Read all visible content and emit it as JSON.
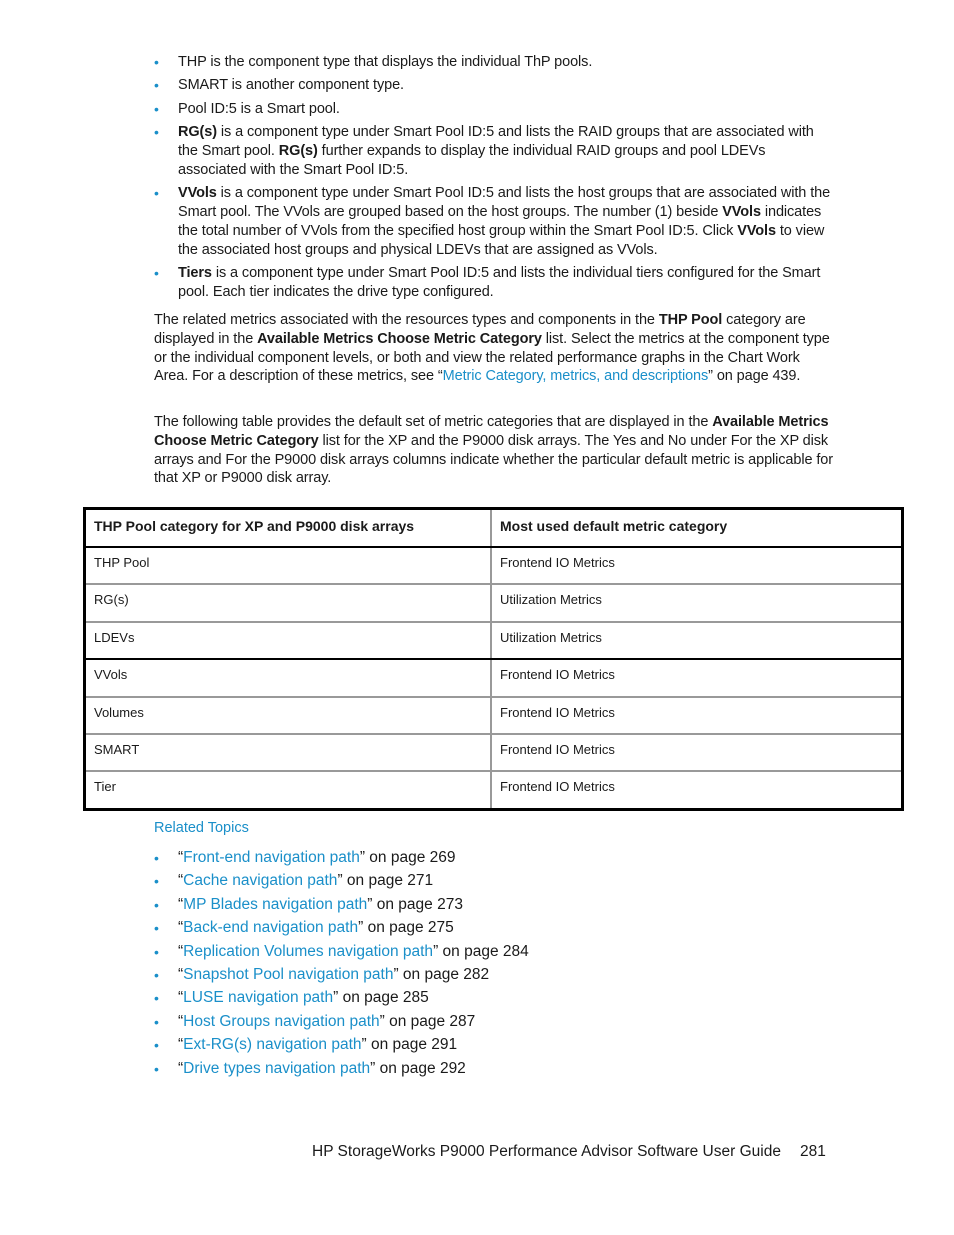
{
  "bullets": [
    {
      "bold": "",
      "text": "THP is the component type that displays the individual ThP pools."
    },
    {
      "bold": "",
      "text": "SMART is another component type."
    },
    {
      "bold": "",
      "text": "Pool ID:5 is a Smart pool."
    },
    {
      "segments": [
        {
          "b": "RG(s)"
        },
        {
          "t": " is a component type under Smart Pool ID:5 and lists the RAID groups that are associated with the Smart pool. "
        },
        {
          "b": "RG(s)"
        },
        {
          "t": " further expands to display the individual RAID groups and pool LDEVs associated with the Smart Pool ID:5."
        }
      ]
    },
    {
      "segments": [
        {
          "b": "VVols"
        },
        {
          "t": " is a component type under Smart Pool ID:5 and lists the host groups that are associated with the Smart pool. The VVols are grouped based on the host groups. The number (1) beside "
        },
        {
          "b": "VVols"
        },
        {
          "t": " indicates the total number of VVols from the specified host group within the Smart Pool ID:5. Click "
        },
        {
          "b": "VVols"
        },
        {
          "t": " to view the associated host groups and physical LDEVs that are assigned as VVols."
        }
      ]
    },
    {
      "segments": [
        {
          "b": "Tiers"
        },
        {
          "t": " is a component type under Smart Pool ID:5 and lists the individual tiers configured for the Smart pool. Each tier indicates the drive type configured."
        }
      ]
    }
  ],
  "para1": {
    "t1": "The related metrics associated with the resources types and components in the ",
    "b1": "THP Pool",
    "t2": " category are displayed in the ",
    "b2": "Available Metrics Choose Metric Category",
    "t3": " list. Select the metrics at the component type or the individual component levels, or both and view the related performance graphs in the Chart Work Area. For a description of these metrics, see “",
    "link": "Metric Category, metrics, and descriptions",
    "t4": "” on page 439."
  },
  "para2": {
    "t1": "The following table provides the default set of metric categories that are displayed in the ",
    "b1": "Available Metrics Choose Metric Category",
    "t2": " list for the XP and the P9000 disk arrays. The Yes and No under For the XP disk arrays and For the P9000 disk arrays columns indicate whether the particular default metric is applicable for that XP or P9000 disk array."
  },
  "table": {
    "headers": [
      "THP Pool category for XP and P9000 disk arrays",
      "Most used default metric category"
    ],
    "rows": [
      [
        "THP Pool",
        "Frontend IO Metrics"
      ],
      [
        "RG(s)",
        "Utilization Metrics"
      ],
      [
        "LDEVs",
        "Utilization Metrics"
      ],
      [
        "VVols",
        "Frontend IO Metrics"
      ],
      [
        "Volumes",
        "Frontend IO Metrics"
      ],
      [
        "SMART",
        "Frontend IO Metrics"
      ],
      [
        "Tier",
        "Frontend IO Metrics"
      ]
    ]
  },
  "related": {
    "title": "Related Topics",
    "items": [
      {
        "link": "Front-end navigation path",
        "suffix": "” on page 269"
      },
      {
        "link": "Cache navigation path",
        "suffix": "” on page 271"
      },
      {
        "link": "MP Blades navigation path",
        "suffix": "” on page 273"
      },
      {
        "link": "Back-end navigation path",
        "suffix": "” on page 275"
      },
      {
        "link": "Replication Volumes navigation path",
        "suffix": "” on page 284"
      },
      {
        "link": "Snapshot Pool navigation path",
        "suffix": "” on page 282"
      },
      {
        "link": "LUSE navigation path",
        "suffix": "” on page 285"
      },
      {
        "link": "Host Groups navigation path",
        "suffix": "” on page 287"
      },
      {
        "link": "Ext-RG(s) navigation path",
        "suffix": "” on page 291"
      },
      {
        "link": "Drive types navigation path",
        "suffix": "” on page 292"
      }
    ],
    "open_quote": "“",
    "bullet": "•"
  },
  "footer": {
    "title": "HP StorageWorks P9000 Performance Advisor Software User Guide",
    "page_number": "281"
  }
}
